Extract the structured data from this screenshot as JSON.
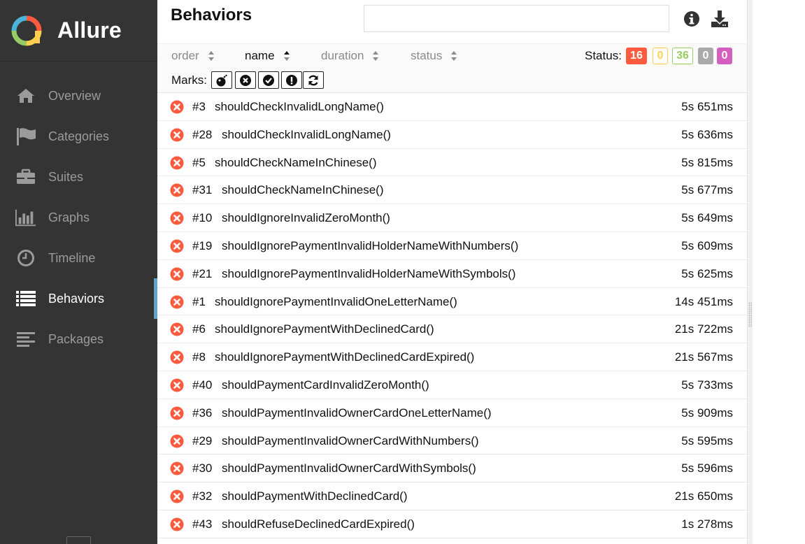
{
  "app": {
    "name": "Allure"
  },
  "nav": [
    {
      "label": "Overview",
      "icon": "home-icon",
      "active": false
    },
    {
      "label": "Categories",
      "icon": "flag-icon",
      "active": false
    },
    {
      "label": "Suites",
      "icon": "briefcase-icon",
      "active": false
    },
    {
      "label": "Graphs",
      "icon": "bar-chart-icon",
      "active": false
    },
    {
      "label": "Timeline",
      "icon": "clock-icon",
      "active": false
    },
    {
      "label": "Behaviors",
      "icon": "list-icon",
      "active": true
    },
    {
      "label": "Packages",
      "icon": "align-left-icon",
      "active": false
    }
  ],
  "header": {
    "title": "Behaviors",
    "search_value": "",
    "icons": [
      "info-icon",
      "download-icon"
    ]
  },
  "sort": {
    "items": [
      "order",
      "name",
      "duration",
      "status"
    ],
    "active": "name"
  },
  "status_filter": {
    "label": "Status:",
    "counts": [
      {
        "value": "16",
        "color": "#fd5a3e",
        "kind": "failed"
      },
      {
        "value": "0",
        "color": "#ffd050",
        "kind": "broken"
      },
      {
        "value": "36",
        "color": "#97cc64",
        "kind": "passed"
      },
      {
        "value": "0",
        "color": "#aaaaaa",
        "kind": "skipped"
      },
      {
        "value": "0",
        "color": "#d35ebe",
        "kind": "unknown"
      }
    ]
  },
  "marks": {
    "label": "Marks:",
    "items": [
      "bomb-icon",
      "x-circle-icon",
      "check-circle-icon",
      "exclamation-circle-icon",
      "refresh-icon"
    ]
  },
  "tests": [
    {
      "num": "#3",
      "name": "shouldCheckInvalidLongName()",
      "duration": "5s 651ms"
    },
    {
      "num": "#28",
      "name": "shouldCheckInvalidLongName()",
      "duration": "5s 636ms"
    },
    {
      "num": "#5",
      "name": "shouldCheckNameInChinese()",
      "duration": "5s 815ms"
    },
    {
      "num": "#31",
      "name": "shouldCheckNameInChinese()",
      "duration": "5s 677ms"
    },
    {
      "num": "#10",
      "name": "shouldIgnoreInvalidZeroMonth()",
      "duration": "5s 649ms"
    },
    {
      "num": "#19",
      "name": "shouldIgnorePaymentInvalidHolderNameWithNumbers()",
      "duration": "5s 609ms"
    },
    {
      "num": "#21",
      "name": "shouldIgnorePaymentInvalidHolderNameWithSymbols()",
      "duration": "5s 625ms"
    },
    {
      "num": "#1",
      "name": "shouldIgnorePaymentInvalidOneLetterName()",
      "duration": "14s 451ms"
    },
    {
      "num": "#6",
      "name": "shouldIgnorePaymentWithDeclinedCard()",
      "duration": "21s 722ms"
    },
    {
      "num": "#8",
      "name": "shouldIgnorePaymentWithDeclinedCardExpired()",
      "duration": "21s 567ms"
    },
    {
      "num": "#40",
      "name": "shouldPaymentCardInvalidZeroMonth()",
      "duration": "5s 733ms"
    },
    {
      "num": "#36",
      "name": "shouldPaymentInvalidOwnerCardOneLetterName()",
      "duration": "5s 909ms"
    },
    {
      "num": "#29",
      "name": "shouldPaymentInvalidOwnerCardWithNumbers()",
      "duration": "5s 595ms"
    },
    {
      "num": "#30",
      "name": "shouldPaymentInvalidOwnerCardWithSymbols()",
      "duration": "5s 596ms"
    },
    {
      "num": "#32",
      "name": "shouldPaymentWithDeclinedCard()",
      "duration": "21s 650ms"
    },
    {
      "num": "#43",
      "name": "shouldRefuseDeclinedCardExpired()",
      "duration": "1s 278ms"
    }
  ]
}
